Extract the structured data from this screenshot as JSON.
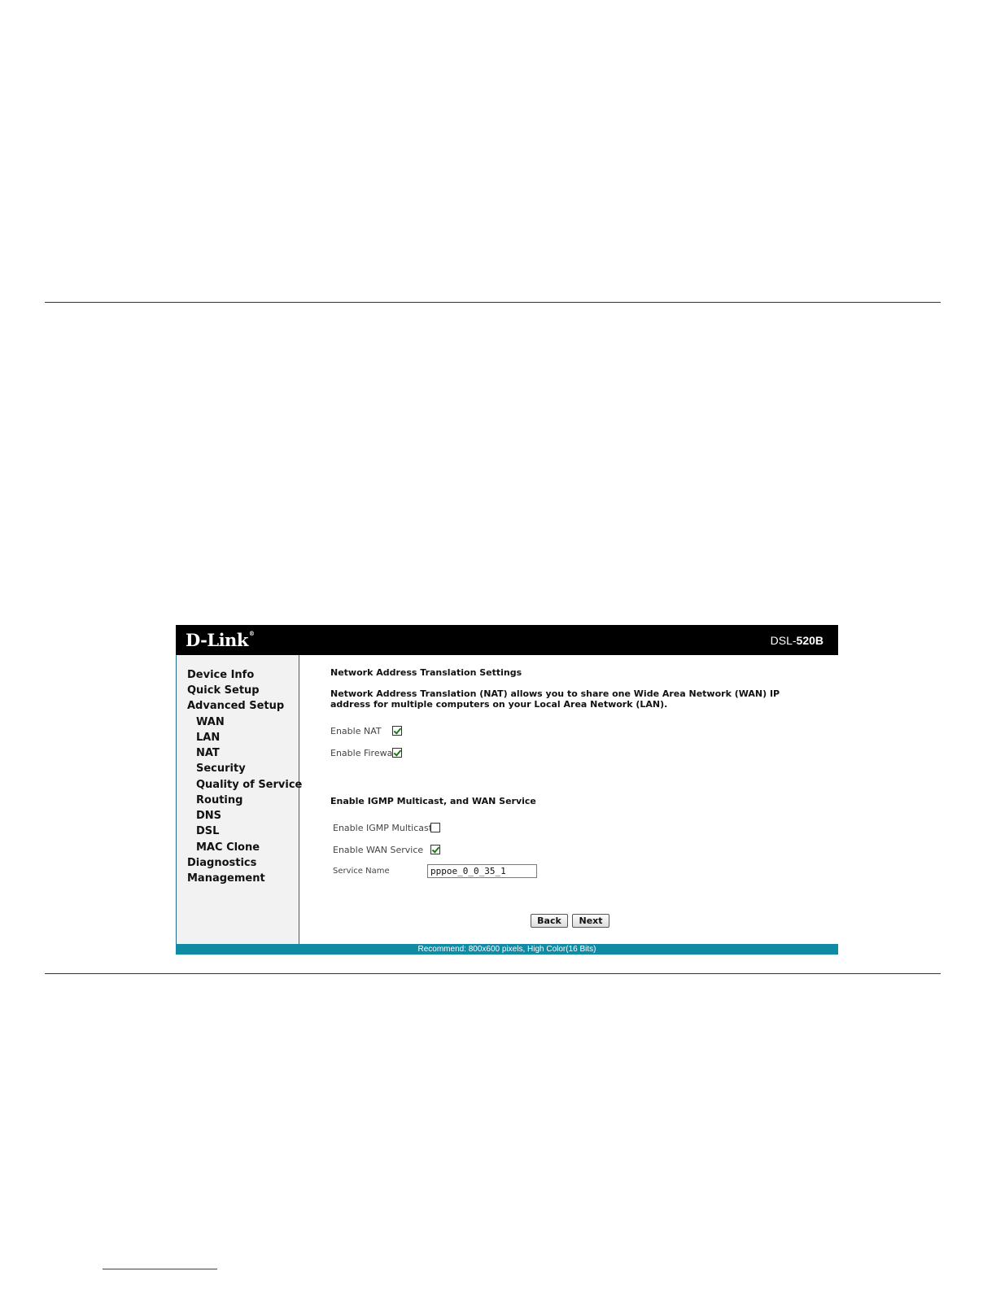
{
  "brand": {
    "logo": "D-Link",
    "logo_mark": "®",
    "model_prefix": "DSL-",
    "model_number": "520B"
  },
  "sidebar": {
    "items": [
      {
        "label": "Device Info"
      },
      {
        "label": "Quick Setup"
      },
      {
        "label": "Advanced Setup"
      },
      {
        "label": "WAN"
      },
      {
        "label": "LAN"
      },
      {
        "label": "NAT"
      },
      {
        "label": "Security"
      },
      {
        "label": "Quality of Service"
      },
      {
        "label": "Routing"
      },
      {
        "label": "DNS"
      },
      {
        "label": "DSL"
      },
      {
        "label": "MAC Clone"
      },
      {
        "label": "Diagnostics"
      },
      {
        "label": "Management"
      }
    ]
  },
  "nat": {
    "title": "Network Address Translation Settings",
    "description": "Network Address Translation (NAT) allows you to share one Wide Area Network (WAN) IP address for multiple computers on your Local Area Network (LAN).",
    "enable_nat_label": "Enable NAT",
    "enable_nat_checked": true,
    "enable_firewall_label": "Enable Firewal",
    "enable_firewall_checked": true
  },
  "service": {
    "title": "Enable IGMP Multicast, and WAN Service",
    "igmp_label": "Enable IGMP Multicast",
    "igmp_checked": false,
    "wan_label": "Enable WAN Service",
    "wan_checked": true,
    "service_name_label": "Service Name",
    "service_name_value": "pppoe_0_0_35_1"
  },
  "buttons": {
    "back": "Back",
    "next": "Next"
  },
  "footer": {
    "text": "Recommend: 800x600 pixels, High Color(16 Bits)"
  },
  "colors": {
    "header": "#000000",
    "footer": "#118aa3",
    "sidebar": "#f2f2f2",
    "check": "#1a7a1a"
  }
}
